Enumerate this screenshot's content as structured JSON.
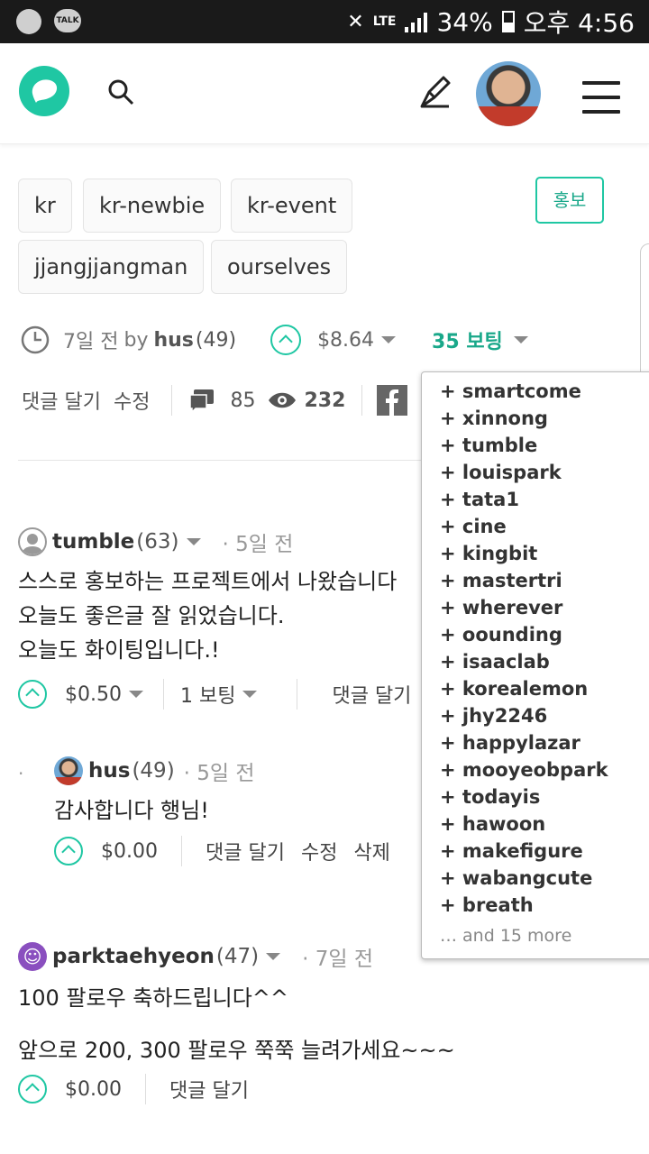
{
  "statusbar": {
    "talk": "TALK",
    "network": "LTE",
    "battery": "34%",
    "time": "오후 4:56"
  },
  "header": {
    "logo": "steemit-logo-icon",
    "search": "search-icon",
    "write": "pen-icon",
    "avatar": "user-avatar",
    "menu": "hamburger-menu-icon"
  },
  "tags": [
    "kr",
    "kr-newbie",
    "kr-event",
    "jjangjjangman",
    "ourselves"
  ],
  "promote_label": "홍보",
  "post": {
    "time": "7일 전",
    "by": "by",
    "author": "hus",
    "rep": "(49)",
    "payout": "$8.64",
    "votes": "35 보팅",
    "reply": "댓글 달기",
    "edit": "수정",
    "comment_count": "85",
    "view_count": "232"
  },
  "voters": [
    "+ smartcome",
    "+ xinnong",
    "+ tumble",
    "+ louispark",
    "+ tata1",
    "+ cine",
    "+ kingbit",
    "+ mastertri",
    "+ wherever",
    "+ oounding",
    "+ isaaclab",
    "+ korealemon",
    "+ jhy2246",
    "+ happylazar",
    "+ mooyeobpark",
    "+ todayis",
    "+ hawoon",
    "+ makefigure",
    "+ wabangcute",
    "+ breath"
  ],
  "voters_more": "… and 15 more",
  "comments": [
    {
      "author": "tumble",
      "rep": "(63)",
      "time": "· 5일 전",
      "lines": [
        "스스로 홍보하는 프로젝트에서 나왔습니다",
        "오늘도 좋은글 잘 읽었습니다.",
        "오늘도 화이팅입니다.!"
      ],
      "payout": "$0.50",
      "votes": "1 보팅",
      "reply": "댓글 달기"
    },
    {
      "author": "hus",
      "rep": "(49)",
      "time": "· 5일 전",
      "lines": [
        "감사합니다 행님!"
      ],
      "payout": "$0.00",
      "reply": "댓글 달기",
      "edit": "수정",
      "delete": "삭제"
    },
    {
      "author": "parktaehyeon",
      "rep": "(47)",
      "time": "· 7일 전",
      "lines": [
        "100 팔로우 축하드립니다^^",
        "앞으로 200, 300 팔로우 쭉쭉 늘려가세요~~~"
      ],
      "payout": "$0.00",
      "reply": "댓글 달기"
    }
  ]
}
